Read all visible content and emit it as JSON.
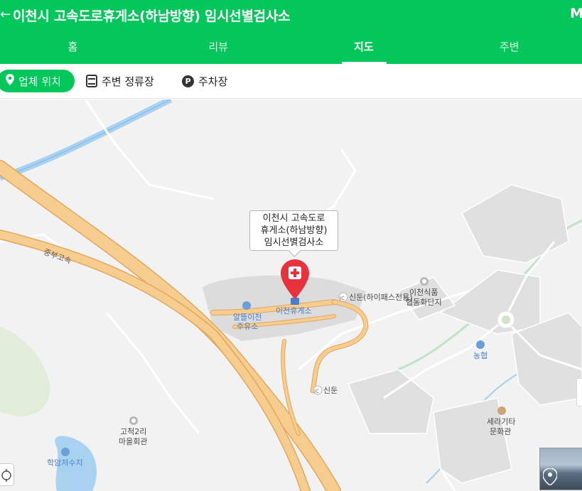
{
  "header": {
    "back_icon": "←",
    "title": "이천시 고속도로휴게소(하남방향) 임시선별검사소",
    "right_mark": "M"
  },
  "tabs": [
    {
      "label": "홈",
      "active": false
    },
    {
      "label": "리뷰",
      "active": false
    },
    {
      "label": "지도",
      "active": true
    },
    {
      "label": "주변",
      "active": false
    }
  ],
  "chips": [
    {
      "label": "업체 위치",
      "icon": "location-pin-icon",
      "active": true
    },
    {
      "label": "주변 정류장",
      "icon": "bus-icon",
      "active": false
    },
    {
      "label": "주차장",
      "icon": "parking-icon",
      "active": false
    }
  ],
  "map": {
    "callout_lines": [
      "이천시 고속도로",
      "휴게소(하남방향)",
      "임시선별검사소"
    ],
    "labels": {
      "jungbu": "중부고속",
      "rest_area": "이천휴게소",
      "gas1": "알뜰이천",
      "gas2": "주유소",
      "ic_hipass": "신둔(하이패스전용)",
      "ic_sindun": "신둔",
      "complex1": "이천식품",
      "complex2": "협동화단지",
      "nh": "농협",
      "seramic1": "세라기타",
      "seramic2": "문화관",
      "village1": "고척2리",
      "village2": "마을회관",
      "reservoir": "학암저수지",
      "ic_badge": "IC"
    },
    "colors": {
      "brand_green": "#03c75a",
      "highway": "#f6cc8f",
      "highway_edge": "#e3a75d",
      "marker_red": "#e8323d",
      "water": "#a8d2f0",
      "green_area": "#dcebd2"
    }
  }
}
